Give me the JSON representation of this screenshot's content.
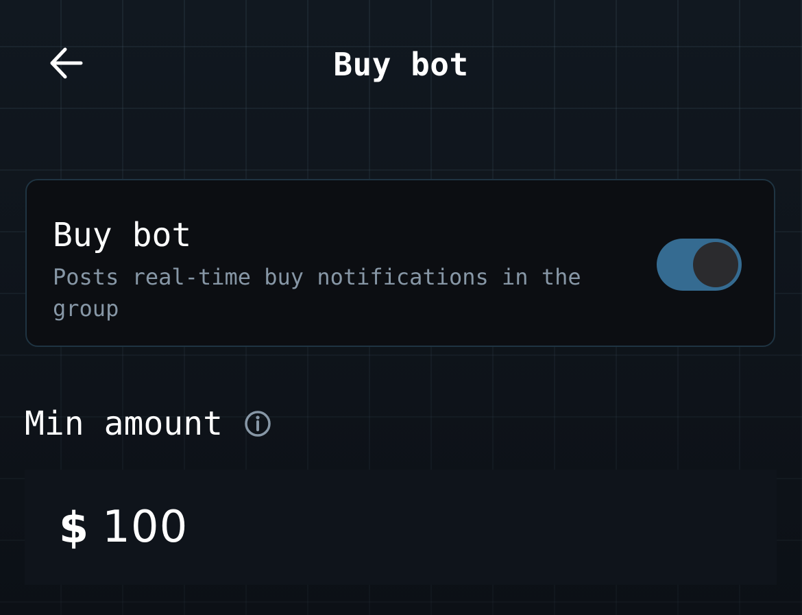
{
  "header": {
    "title": "Buy bot",
    "back_icon": "arrow-left-icon"
  },
  "buy_bot_card": {
    "title": "Buy bot",
    "description": "Posts real-time buy notifications in the group",
    "toggle_on": true,
    "toggle_color": "#356b91"
  },
  "min_amount": {
    "label": "Min amount",
    "info_icon": "info-icon",
    "currency": "$",
    "value": "100"
  },
  "colors": {
    "background": "#111820",
    "card_background": "#0c0e12",
    "card_border": "#1f3442",
    "muted_text": "#8797a6",
    "field_background": "#0f141b"
  }
}
